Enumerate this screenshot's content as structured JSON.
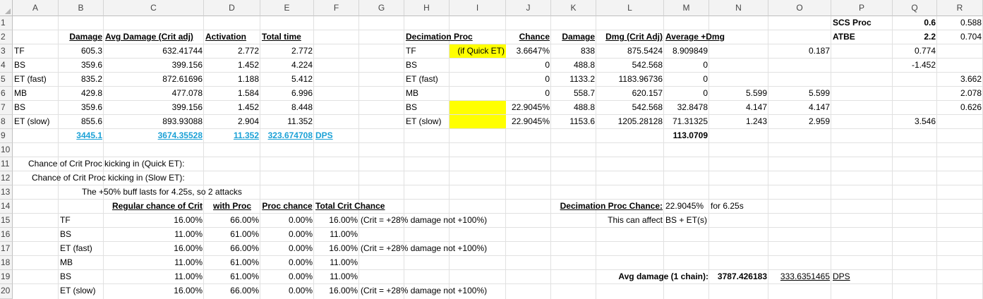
{
  "columns": [
    "A",
    "B",
    "C",
    "D",
    "E",
    "F",
    "G",
    "H",
    "I",
    "J",
    "K",
    "L",
    "M",
    "N",
    "O",
    "P",
    "Q",
    "R"
  ],
  "rows": [
    "1",
    "2",
    "3",
    "4",
    "5",
    "6",
    "7",
    "8",
    "9",
    "10",
    "11",
    "12",
    "13",
    "14",
    "15",
    "16",
    "17",
    "18",
    "19",
    "20"
  ],
  "colors": {
    "highlight": "#ffff00",
    "link": "#1ba1d6",
    "grid": "#e1e1e1",
    "header_bg": "#f3f3f3"
  },
  "cells": {
    "P1": "SCS Proc",
    "Q1": "0.6",
    "R1": "0.588",
    "B2": "Damage",
    "C2": "Avg Damage (Crit adj)",
    "D2": "Activation",
    "E2": "Total time",
    "H2": "Decimation Proc",
    "J2": "Chance",
    "K2": "Damage",
    "L2": "Dmg (Crit Adj)",
    "M2": "Average +Dmg",
    "P2": "ATBE",
    "Q2": "2.2",
    "R2": "0.704",
    "A3": "TF",
    "B3": "605.3",
    "C3": "632.41744",
    "D3": "2.772",
    "E3": "2.772",
    "H3": "TF",
    "I3": "(if Quick ET)",
    "J3": "3.6647%",
    "K3": "838",
    "L3": "875.5424",
    "M3": "8.909849",
    "O3": "0.187",
    "Q3": "0.774",
    "A4": "BS",
    "B4": "359.6",
    "C4": "399.156",
    "D4": "1.452",
    "E4": "4.224",
    "H4": "BS",
    "J4": "0",
    "K4": "488.8",
    "L4": "542.568",
    "M4": "0",
    "Q4": "-1.452",
    "A5": "ET (fast)",
    "B5": "835.2",
    "C5": "872.61696",
    "D5": "1.188",
    "E5": "5.412",
    "H5": "ET (fast)",
    "J5": "0",
    "K5": "1133.2",
    "L5": "1183.96736",
    "M5": "0",
    "R5": "3.662",
    "A6": "MB",
    "B6": "429.8",
    "C6": "477.078",
    "D6": "1.584",
    "E6": "6.996",
    "H6": "MB",
    "J6": "0",
    "K6": "558.7",
    "L6": "620.157",
    "M6": "0",
    "N6": "5.599",
    "O6": "5.599",
    "R6": "2.078",
    "A7": "BS",
    "B7": "359.6",
    "C7": "399.156",
    "D7": "1.452",
    "E7": "8.448",
    "H7": "BS",
    "J7": "22.9045%",
    "K7": "488.8",
    "L7": "542.568",
    "M7": "32.8478",
    "N7": "4.147",
    "O7": "4.147",
    "R7": "0.626",
    "A8": "ET (slow)",
    "B8": "855.6",
    "C8": "893.93088",
    "D8": "2.904",
    "E8": "11.352",
    "H8": "ET (slow)",
    "J8": "22.9045%",
    "K8": "1153.6",
    "L8": "1205.28128",
    "M8": "71.31325",
    "N8": "1.243",
    "O8": "2.959",
    "Q8": "3.546",
    "B9": "3445.1",
    "C9": "3674.35528",
    "D9": "11.352",
    "E9": "323.674708",
    "F9": "DPS",
    "M9": "113.0709",
    "A11": "Chance of Crit Proc kicking in (Quick ET):",
    "A12": "Chance of Crit Proc kicking in (Slow ET):",
    "A13": "The +50% buff lasts for 4.25s, so 2 attacks",
    "C14": "Regular chance of Crit",
    "D14": "with Proc",
    "E14": "Proc chance",
    "F14": "Total Crit Chance",
    "L14": "Decimation Proc Chance:",
    "M14": "22.9045%",
    "N14": "for 6.25s",
    "B15": "TF",
    "C15": "16.00%",
    "D15": "66.00%",
    "E15": "0.00%",
    "F15": "16.00%",
    "G15": "(Crit = +28% damage not +100%)",
    "L15": "This can affect",
    "M15": "BS + ET(s)",
    "B16": "BS",
    "C16": "11.00%",
    "D16": "61.00%",
    "E16": "0.00%",
    "F16": "11.00%",
    "B17": "ET (fast)",
    "C17": "16.00%",
    "D17": "66.00%",
    "E17": "0.00%",
    "F17": "16.00%",
    "G17": "(Crit = +28% damage not +100%)",
    "B18": "MB",
    "C18": "11.00%",
    "D18": "61.00%",
    "E18": "0.00%",
    "F18": "11.00%",
    "B19": "BS",
    "C19": "11.00%",
    "D19": "61.00%",
    "E19": "0.00%",
    "F19": "11.00%",
    "L19": "Avg damage (1 chain):",
    "M19": "3787.426183",
    "N19": "333.6351465",
    "P19": "DPS",
    "B20": "ET (slow)",
    "C20": "16.00%",
    "D20": "66.00%",
    "E20": "0.00%",
    "F20": "16.00%",
    "G20": "(Crit = +28% damage not +100%)"
  }
}
